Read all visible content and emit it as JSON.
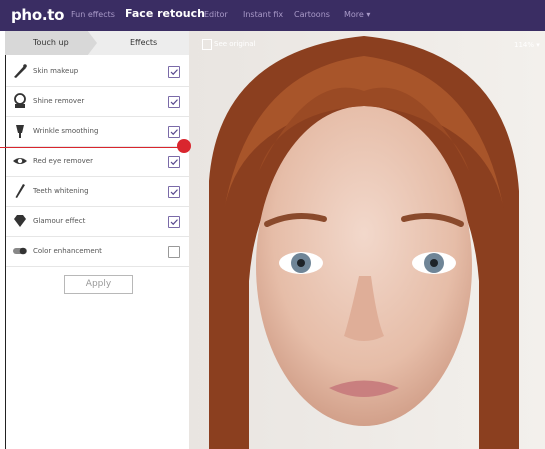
{
  "header": {
    "logo": "pho.to",
    "nav": [
      "Fun effects",
      "Face retouch",
      "Editor",
      "Instant fix",
      "Cartoons",
      "More ▾"
    ],
    "active_nav": "Face retouch"
  },
  "tabs": {
    "touch_up": "Touch up",
    "effects": "Effects"
  },
  "options": [
    {
      "label": "Skin makeup",
      "icon": "brush-icon",
      "checked": true
    },
    {
      "label": "Shine remover",
      "icon": "sponge-icon",
      "checked": true
    },
    {
      "label": "Wrinkle smoothing",
      "icon": "iron-icon",
      "checked": true
    },
    {
      "label": "Red eye remover",
      "icon": "eye-icon",
      "checked": true
    },
    {
      "label": "Teeth whitening",
      "icon": "tooth-brush-icon",
      "checked": true
    },
    {
      "label": "Glamour effect",
      "icon": "diamond-icon",
      "checked": true
    },
    {
      "label": "Color enhancement",
      "icon": "toggle-icon",
      "checked": false
    }
  ],
  "apply_label": "Apply",
  "viewer": {
    "see_original": "See original",
    "zoom": "114% ▾"
  },
  "colors": {
    "header_bg": "#3a2d63",
    "accent": "#7a6aa8",
    "callout": "#d9262e"
  }
}
